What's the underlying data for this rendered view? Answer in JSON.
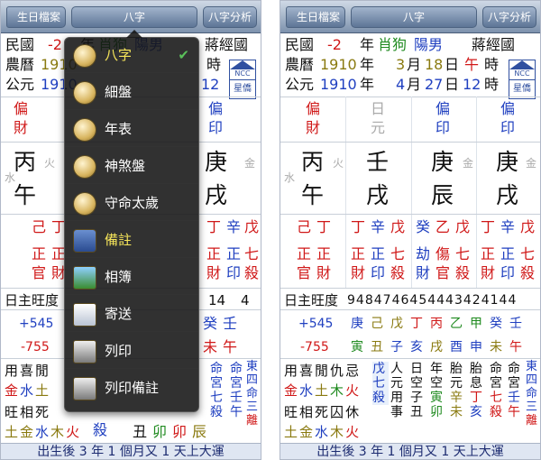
{
  "nav": {
    "back_label": "生日檔案",
    "title": "八字",
    "action_label": "八字分析"
  },
  "header": {
    "row1": {
      "k1": "民國",
      "v1": "-2",
      "k2": "年",
      "v2": "肖狗",
      "v3": "陽男",
      "v4": "蔣經國"
    },
    "row2": {
      "k1": "農曆",
      "v1": "1910",
      "k2": "年",
      "v2": "3",
      "k3": "月",
      "v3": "18",
      "k4": "日",
      "v4": "午",
      "k5": "時"
    },
    "row3": {
      "k1": "公元",
      "v1": "1910",
      "k2": "年",
      "v2": "4",
      "k3": "月",
      "v3": "27",
      "k4": "日",
      "v4": "12",
      "k5": "時"
    },
    "seal": {
      "top": "NCC",
      "bottom": "星僑"
    }
  },
  "ten_gods_top": [
    [
      "偏",
      "財"
    ],
    [
      "日",
      "元"
    ],
    [
      "偏",
      "印"
    ],
    [
      "偏",
      "印"
    ]
  ],
  "stems": [
    "丙",
    "壬",
    "庚",
    "庚"
  ],
  "branches": [
    "午",
    "戌",
    "辰",
    "戌"
  ],
  "stem_small": [
    [
      "水",
      "火"
    ],
    [
      "",
      ""
    ],
    [
      "",
      "金"
    ],
    [
      "",
      "金"
    ]
  ],
  "hidden_stems": [
    [
      "己",
      "丁"
    ],
    [
      "丁",
      "辛",
      "戊"
    ],
    [
      "癸",
      "乙",
      "戊"
    ],
    [
      "丁",
      "辛",
      "戊"
    ]
  ],
  "hidden_gods": [
    [
      [
        "正",
        "官"
      ],
      [
        "正",
        "財"
      ]
    ],
    [
      [
        "正",
        "財"
      ],
      [
        "正",
        "印"
      ],
      [
        "七",
        "殺"
      ]
    ],
    [
      [
        "劫",
        "財"
      ],
      [
        "傷",
        "官"
      ],
      [
        "七",
        "殺"
      ]
    ],
    [
      [
        "正",
        "財"
      ],
      [
        "正",
        "印"
      ],
      [
        "七",
        "殺"
      ]
    ]
  ],
  "strength": {
    "label": "日主旺度",
    "values": [
      "94",
      "84",
      "74",
      "64",
      "54",
      "44",
      "34",
      "24",
      "14",
      "4"
    ]
  },
  "luck": {
    "plus": "+545",
    "minus": "-755",
    "top": [
      "庚",
      "己",
      "戊",
      "丁",
      "丙",
      "乙",
      "甲",
      "癸",
      "壬"
    ],
    "bottom": [
      "寅",
      "丑",
      "子",
      "亥",
      "戌",
      "酉",
      "申",
      "未",
      "午"
    ]
  },
  "bottom_left": {
    "row1": [
      "用",
      "喜",
      "閒",
      "仇",
      "忌"
    ],
    "row2": [
      "金",
      "水",
      "土",
      "木",
      "火"
    ],
    "row3": [
      "旺",
      "相",
      "死",
      "囚",
      "休"
    ],
    "row4": [
      "土",
      "金",
      "水",
      "木",
      "火"
    ]
  },
  "bottom_mid": {
    "c1": [
      "戊"
    ],
    "c2": [
      "七",
      "殺"
    ],
    "c3": [
      "人",
      "元",
      "用",
      "事"
    ],
    "c4": [
      "日",
      "空",
      "子",
      "丑"
    ],
    "c5": [
      "年",
      "空",
      "寅",
      "卯"
    ],
    "c6": [
      "胎",
      "元",
      "辛",
      "未"
    ],
    "c7": [
      "胎",
      "息",
      "丁",
      "亥"
    ],
    "c8": [
      "命",
      "宮",
      "七",
      "殺"
    ],
    "c9": [
      "命",
      "宮",
      "壬",
      "午"
    ],
    "c10": [
      "東",
      "四",
      "命",
      "三",
      "離"
    ]
  },
  "left_extra": {
    "c1": [
      "殺"
    ],
    "c2": [
      "寅"
    ],
    "c3": [
      "丑"
    ],
    "c4": [
      "卯"
    ],
    "c5": [
      "卯"
    ],
    "c6": [
      "辰"
    ]
  },
  "footer": "出生後 3 年 1 個月又 1 天上大運",
  "menu": {
    "items": [
      {
        "label": "八字",
        "icon": "bazi-coin-icon",
        "selected": true,
        "check": "✔"
      },
      {
        "label": "細盤",
        "icon": "bazi-coin-icon"
      },
      {
        "label": "年表",
        "icon": "bazi-coin-icon"
      },
      {
        "label": "神煞盤",
        "icon": "bazi-coin-icon"
      },
      {
        "label": "守命太歲",
        "icon": "bazi-coin-icon"
      },
      {
        "label": "備註",
        "icon": "notebook-icon"
      },
      {
        "label": "相簿",
        "icon": "photo-icon"
      },
      {
        "label": "寄送",
        "icon": "envelope-icon"
      },
      {
        "label": "列印",
        "icon": "printer-icon"
      },
      {
        "label": "列印備註",
        "icon": "printer-icon"
      }
    ]
  }
}
